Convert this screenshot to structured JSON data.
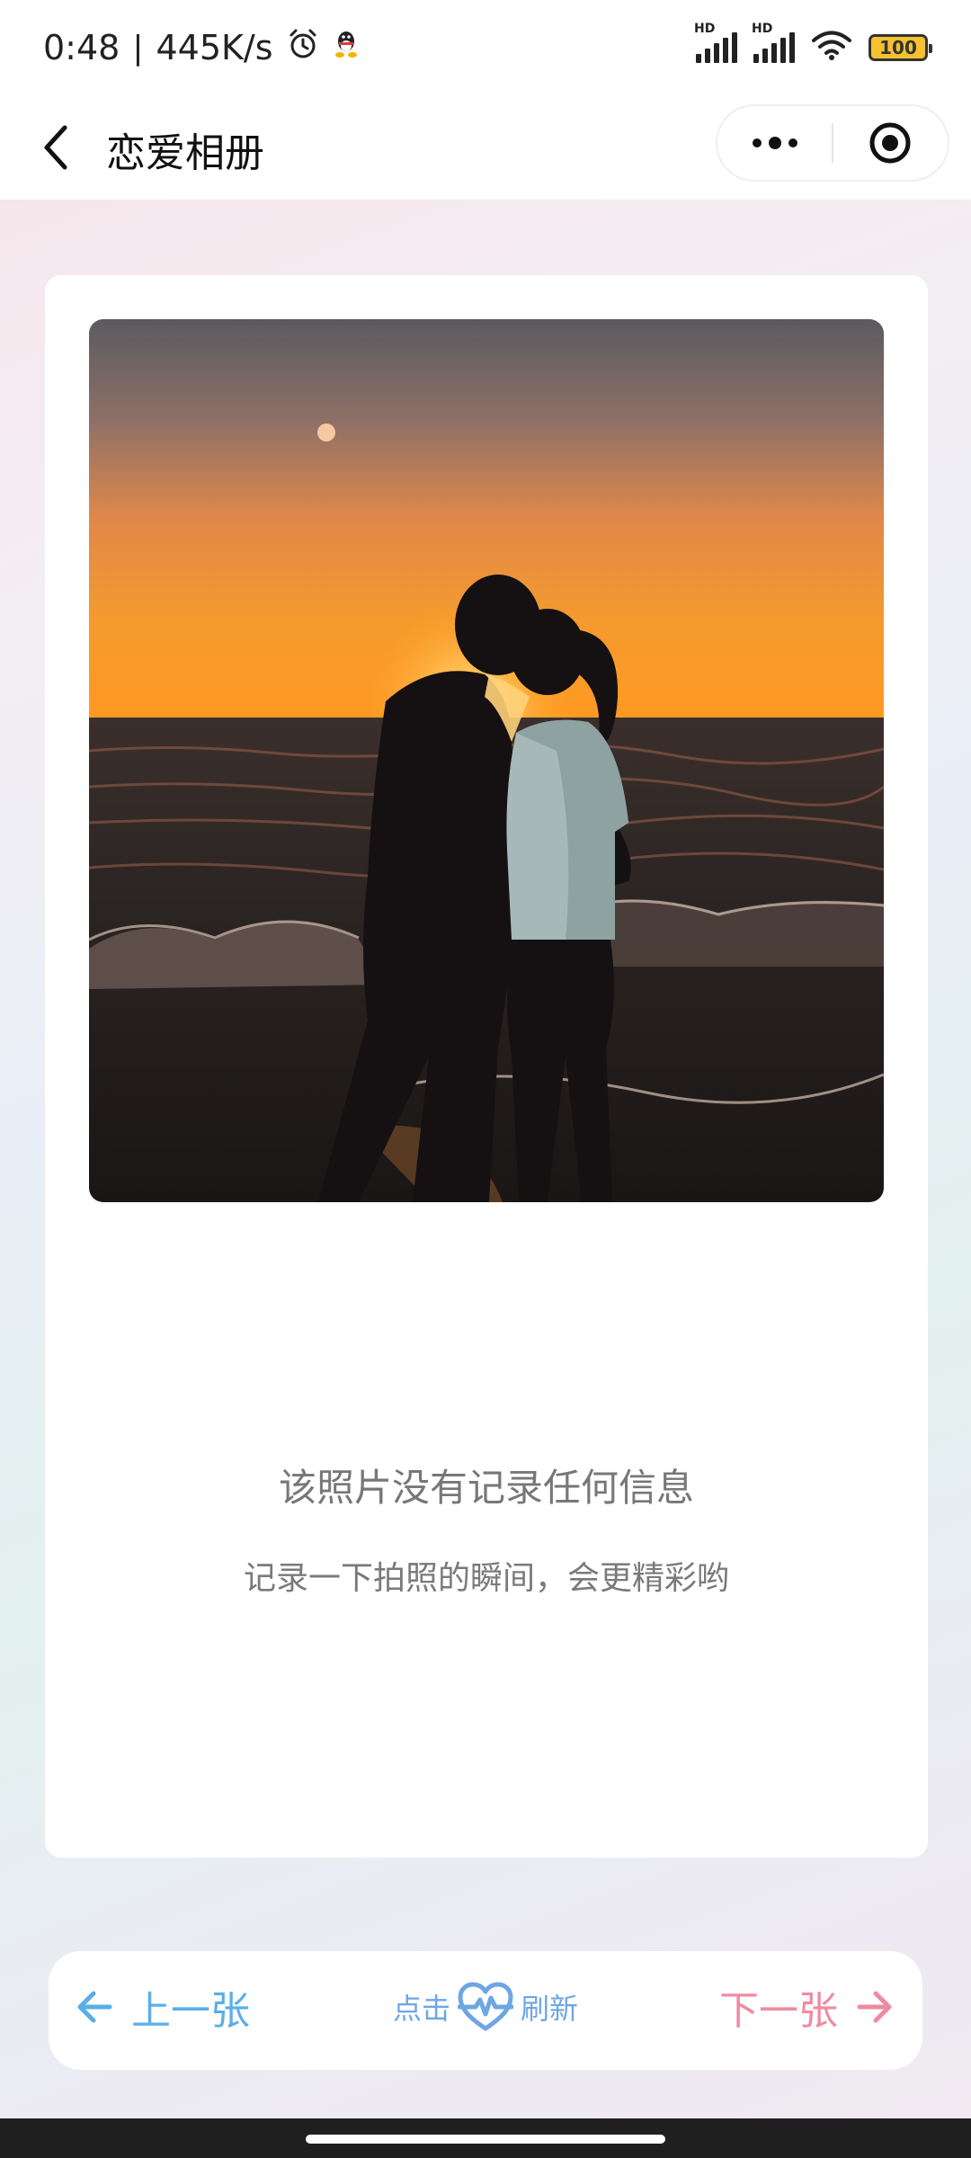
{
  "status_bar": {
    "time": "0:48",
    "speed": "445K/s",
    "battery": "100"
  },
  "nav": {
    "title": "恋爱相册"
  },
  "card": {
    "empty_title": "该照片没有记录任何信息",
    "empty_subtitle": "记录一下拍照的瞬间，会更精彩哟"
  },
  "controls": {
    "prev_label": "上一张",
    "refresh_prefix": "点击",
    "refresh_suffix": "刷新",
    "next_label": "下一张"
  },
  "colors": {
    "prev": "#5aaee8",
    "next": "#ef8aa2",
    "refresh": "#6ea6e4"
  }
}
